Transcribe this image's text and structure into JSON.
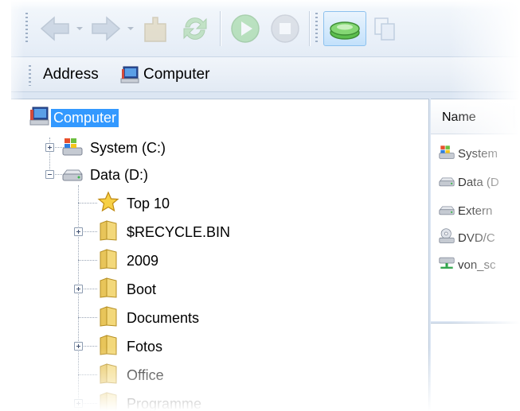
{
  "toolbar": {
    "buttons": [
      {
        "icon": "back-arrow-icon",
        "state": "disabled"
      },
      {
        "icon": "forward-arrow-icon",
        "state": "disabled"
      },
      {
        "icon": "up-folder-icon",
        "state": "disabled"
      },
      {
        "icon": "refresh-icon",
        "state": "disabled"
      },
      {
        "icon": "play-icon",
        "state": "disabled"
      },
      {
        "icon": "stop-icon",
        "state": "disabled"
      },
      {
        "icon": "drive-view-icon",
        "state": "active"
      },
      {
        "icon": "copy-icon",
        "state": "disabled"
      }
    ]
  },
  "address": {
    "label": "Address",
    "value": "Computer",
    "icon": "computer-icon"
  },
  "tree": {
    "root": {
      "label": "Computer",
      "icon": "computer-icon",
      "selected": true
    },
    "drives": [
      {
        "label": "System (C:)",
        "icon": "system-drive-icon",
        "expander": "plus"
      },
      {
        "label": "Data (D:)",
        "icon": "hard-drive-icon",
        "expander": "minus"
      }
    ],
    "folders": [
      {
        "label": "Top 10",
        "icon": "star-icon",
        "expander": ""
      },
      {
        "label": "$RECYCLE.BIN",
        "icon": "folder-icon",
        "expander": "plus"
      },
      {
        "label": "2009",
        "icon": "folder-icon",
        "expander": ""
      },
      {
        "label": "Boot",
        "icon": "folder-icon",
        "expander": "plus"
      },
      {
        "label": "Documents",
        "icon": "folder-icon",
        "expander": ""
      },
      {
        "label": "Fotos",
        "icon": "folder-icon",
        "expander": "plus"
      },
      {
        "label": "Office",
        "icon": "folder-icon",
        "expander": ""
      },
      {
        "label": "Programme",
        "icon": "folder-icon",
        "expander": "plus"
      }
    ]
  },
  "list": {
    "column_name": "Name",
    "items": [
      {
        "label": "System",
        "icon": "system-drive-icon"
      },
      {
        "label": "Data (D",
        "icon": "hard-drive-icon"
      },
      {
        "label": "Extern",
        "icon": "hard-drive-icon"
      },
      {
        "label": "DVD/C",
        "icon": "dvd-drive-icon"
      },
      {
        "label": "von_sc",
        "icon": "network-drive-icon"
      }
    ]
  },
  "colors": {
    "selection": "#3399ff",
    "toolbar": "#e4ecf6",
    "pane_border": "#b7c6d8"
  }
}
